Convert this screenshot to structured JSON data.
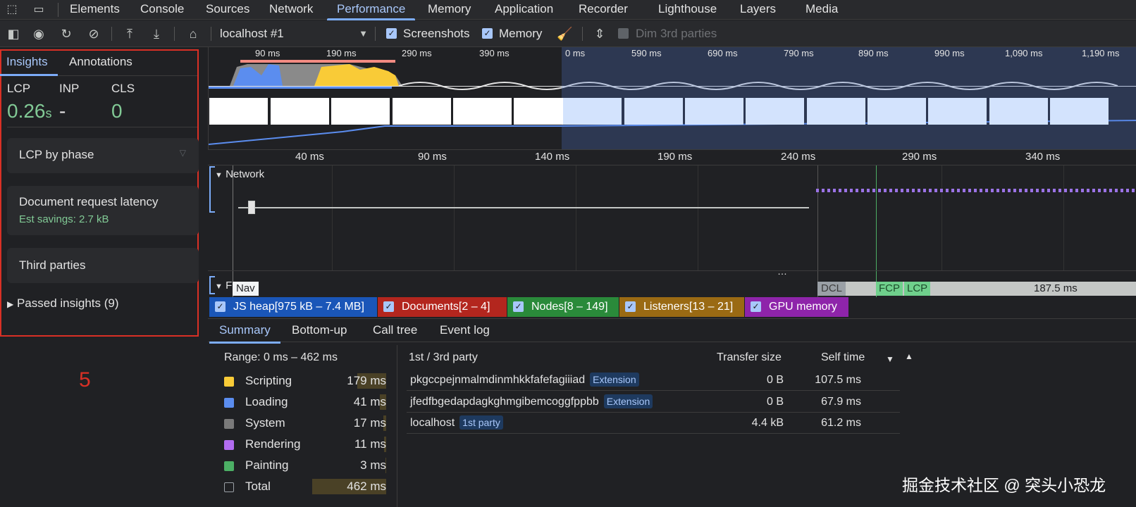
{
  "tabs": [
    "Elements",
    "Console",
    "Sources",
    "Network",
    "Performance",
    "Memory",
    "Application",
    "Recorder",
    "Lighthouse",
    "Layers",
    "Media"
  ],
  "active_tab": "Performance",
  "toolbar": {
    "url": "localhost #1",
    "screenshots_label": "Screenshots",
    "memory_label": "Memory",
    "dim_label": "Dim 3rd parties"
  },
  "sidebar": {
    "tab_insights": "Insights",
    "tab_annotations": "Annotations",
    "lcp_label": "LCP",
    "inp_label": "INP",
    "cls_label": "CLS",
    "lcp_value": "0.26",
    "lcp_unit": "s",
    "inp_value": "-",
    "cls_value": "0",
    "card1": "LCP by phase",
    "card2": "Document request latency",
    "card2_sub": "Est savings: 2.7 kB",
    "card3": "Third parties",
    "passed": "Passed insights (9)"
  },
  "annotation_number": "5",
  "overview_ticks": [
    "90 ms",
    "190 ms",
    "290 ms",
    "390 ms",
    "0 ms",
    "590 ms",
    "690 ms",
    "790 ms",
    "890 ms",
    "990 ms",
    "1,090 ms",
    "1,190 ms"
  ],
  "ruler_ticks": [
    "40 ms",
    "90 ms",
    "140 ms",
    "190 ms",
    "240 ms",
    "290 ms",
    "340 ms"
  ],
  "tracks": {
    "network": "Network",
    "frames_prefix": "F",
    "nav": "Nav",
    "dcl": "DCL",
    "fcp": "FCP",
    "lcp": "LCP",
    "duration": "187.5 ms",
    "more": "…"
  },
  "counters": [
    {
      "label": "JS heap[975 kB – 7.4 MB]",
      "color": "#1a56b8"
    },
    {
      "label": "Documents[2 – 4]",
      "color": "#b3261e"
    },
    {
      "label": "Nodes[8 – 149]",
      "color": "#2a8a3a"
    },
    {
      "label": "Listeners[13 – 21]",
      "color": "#9a6a13"
    },
    {
      "label": "GPU memory",
      "color": "#8e24aa"
    }
  ],
  "bottom_tabs": [
    "Summary",
    "Bottom-up",
    "Call tree",
    "Event log"
  ],
  "summary": {
    "range": "Range: 0 ms – 462 ms",
    "rows": [
      {
        "name": "Scripting",
        "value": "179 ms",
        "color": "#f9cb37"
      },
      {
        "name": "Loading",
        "value": "41 ms",
        "color": "#5b8def"
      },
      {
        "name": "System",
        "value": "17 ms",
        "color": "#7a7a7a"
      },
      {
        "name": "Rendering",
        "value": "11 ms",
        "color": "#b26cf0"
      },
      {
        "name": "Painting",
        "value": "3 ms",
        "color": "#4caf65"
      },
      {
        "name": "Total",
        "value": "462 ms",
        "color": "transparent"
      }
    ]
  },
  "party_table": {
    "col_party": "1st / 3rd party",
    "col_transfer": "Transfer size",
    "col_self": "Self time",
    "rows": [
      {
        "name": "pkgccpejnmalmdinmhkkfafefagiiiad",
        "badge": "Extension",
        "transfer": "0 B",
        "self": "107.5 ms"
      },
      {
        "name": "jfedfbgedapdagkghmgibemcoggfppbb",
        "badge": "Extension",
        "transfer": "0 B",
        "self": "67.9 ms"
      },
      {
        "name": "localhost",
        "badge": "1st party",
        "transfer": "4.4 kB",
        "self": "61.2 ms"
      }
    ]
  },
  "watermark": "掘金技术社区 @ 突头小恐龙"
}
